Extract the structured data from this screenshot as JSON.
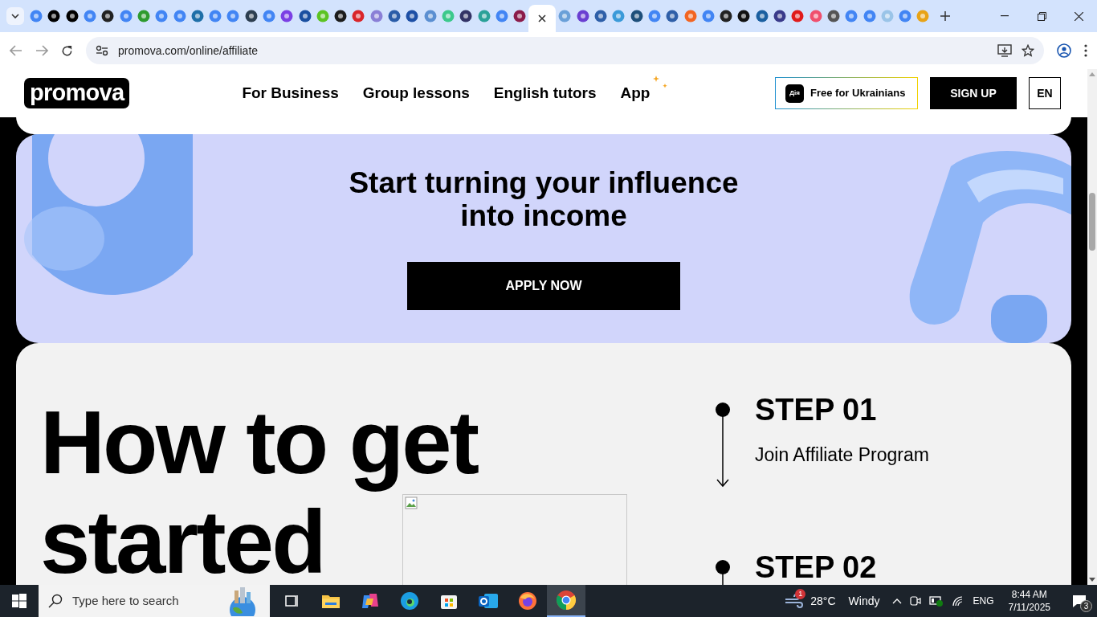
{
  "browser": {
    "tabs": [
      {
        "color": "#4285f4",
        "selected": false
      },
      {
        "color": "#000000",
        "selected": false
      },
      {
        "color": "#000000",
        "selected": false
      },
      {
        "color": "#4285f4",
        "selected": false
      },
      {
        "color": "#222222",
        "selected": false
      },
      {
        "color": "#4285f4",
        "selected": false
      },
      {
        "color": "#2e9b2e",
        "selected": false
      },
      {
        "color": "#4285f4",
        "selected": false
      },
      {
        "color": "#4285f4",
        "selected": false
      },
      {
        "color": "#1f6fa8",
        "selected": false
      },
      {
        "color": "#4285f4",
        "selected": false
      },
      {
        "color": "#4285f4",
        "selected": false
      },
      {
        "color": "#2d3e50",
        "selected": false
      },
      {
        "color": "#4285f4",
        "selected": false
      },
      {
        "color": "#7b3fe4",
        "selected": false
      },
      {
        "color": "#1a4fa0",
        "selected": false
      },
      {
        "color": "#5cc321",
        "selected": false
      },
      {
        "color": "#1c1c1c",
        "selected": false
      },
      {
        "color": "#d9252a",
        "selected": false
      },
      {
        "color": "#8a7fd6",
        "selected": false
      },
      {
        "color": "#2a5ca8",
        "selected": false
      },
      {
        "color": "#1d4fa5",
        "selected": false
      },
      {
        "color": "#5b8fd1",
        "selected": false
      },
      {
        "color": "#3cc98c",
        "selected": false
      },
      {
        "color": "#333366",
        "selected": false
      },
      {
        "color": "#2aa198",
        "selected": false
      },
      {
        "color": "#4285f4",
        "selected": false
      },
      {
        "color": "#8b1c4a",
        "selected": false
      },
      {
        "selected": true
      },
      {
        "color": "#6aa0d8",
        "selected": false
      },
      {
        "color": "#6a3fd1",
        "selected": false
      },
      {
        "color": "#2e5fa8",
        "selected": false
      },
      {
        "color": "#3a9ad9",
        "selected": false
      },
      {
        "color": "#1e4f7a",
        "selected": false
      },
      {
        "color": "#4285f4",
        "selected": false
      },
      {
        "color": "#2f5fa8",
        "selected": false
      },
      {
        "color": "#f26522",
        "selected": false
      },
      {
        "color": "#4285f4",
        "selected": false
      },
      {
        "color": "#222222",
        "selected": false
      },
      {
        "color": "#111111",
        "selected": false
      },
      {
        "color": "#1a5fa0",
        "selected": false
      },
      {
        "color": "#3a3a8a",
        "selected": false
      },
      {
        "color": "#e01b1b",
        "selected": false
      },
      {
        "color": "#f0506e",
        "selected": false
      },
      {
        "color": "#555555",
        "selected": false
      },
      {
        "color": "#4285f4",
        "selected": false
      },
      {
        "color": "#4285f4",
        "selected": false
      },
      {
        "color": "#9ac4e8",
        "selected": false
      },
      {
        "color": "#4285f4",
        "selected": false
      },
      {
        "color": "#e8a317",
        "selected": false
      }
    ],
    "address": "promova.com/online/affiliate"
  },
  "header": {
    "logo": "promova",
    "nav": [
      "For Business",
      "Group lessons",
      "English tutors",
      "App"
    ],
    "diia_badge": "Дія",
    "promo": "Free for Ukrainians",
    "signup": "SIGN UP",
    "language": "EN"
  },
  "banner": {
    "title": [
      "Start turning your influence",
      "into income"
    ],
    "button": "APPLY NOW"
  },
  "steps_section": {
    "heading": [
      "How to get",
      "started"
    ],
    "steps": [
      {
        "label": "STEP 01",
        "text": "Join Affiliate Program"
      },
      {
        "label": "STEP 02"
      }
    ]
  },
  "taskbar": {
    "search_placeholder": "Type here to search",
    "apps": [
      {
        "kind": "taskview",
        "selected": false
      },
      {
        "kind": "folder",
        "selected": false
      },
      {
        "kind": "copilot",
        "selected": false
      },
      {
        "kind": "edge",
        "selected": false
      },
      {
        "kind": "store",
        "selected": false
      },
      {
        "kind": "outlook",
        "selected": false
      },
      {
        "kind": "firefox",
        "selected": false
      },
      {
        "kind": "chrome",
        "selected": true
      }
    ],
    "weather_badge": "1",
    "temperature": "28°C",
    "condition": "Windy",
    "language": "ENG",
    "time": "8:44 AM",
    "date": "7/11/2025",
    "notifications": "3"
  }
}
